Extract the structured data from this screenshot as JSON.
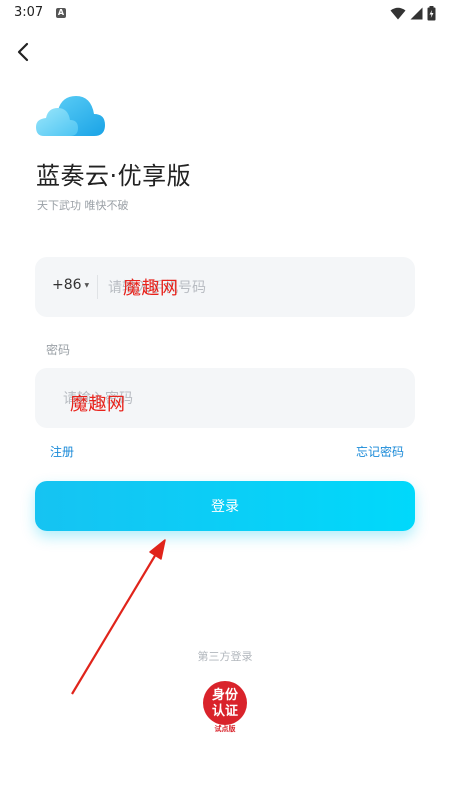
{
  "status_bar": {
    "time": "3:07",
    "notification_icon": "A"
  },
  "app": {
    "title": "蓝奏云·优享版",
    "subtitle": "天下武功 唯快不破"
  },
  "phone": {
    "country_code": "+86",
    "placeholder": "请输入手机号码"
  },
  "password": {
    "label": "密码",
    "placeholder": "请输入密码"
  },
  "links": {
    "register": "注册",
    "forgot": "忘记密码"
  },
  "login_button": "登录",
  "third_party": {
    "label": "第三方登录",
    "badge_line1": "身份",
    "badge_line2": "认证",
    "badge_line3": "试点版"
  },
  "watermark": "魔趣网",
  "colors": {
    "accent": "#16c3f2",
    "link": "#1a8ad8",
    "badge_red": "#d9232b",
    "watermark_red": "#e8231c"
  },
  "icons": [
    "back-arrow-icon",
    "cloud-logo-icon",
    "wifi-icon",
    "signal-icon",
    "battery-icon",
    "id-auth-badge-icon"
  ]
}
